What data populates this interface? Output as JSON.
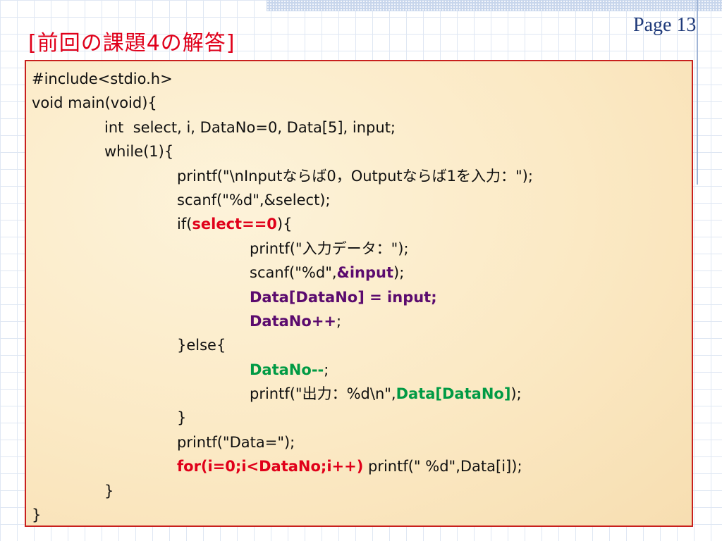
{
  "page_number": "Page 13",
  "title": "[前回の課題4の解答]",
  "colors": {
    "title": "#e0001a",
    "box_border": "#c8201e",
    "highlight_red": "#e0001a",
    "highlight_purple": "#5b0b6e",
    "highlight_green": "#009a44"
  },
  "code": [
    {
      "indent": 0,
      "segments": [
        {
          "text": "#include<stdio.h>",
          "style": "normal"
        }
      ]
    },
    {
      "indent": 0,
      "segments": [
        {
          "text": "void main(void){",
          "style": "normal"
        }
      ]
    },
    {
      "indent": 1,
      "segments": [
        {
          "text": "int  select, i, DataNo=0, Data[5], input;",
          "style": "normal"
        }
      ]
    },
    {
      "indent": 1,
      "segments": [
        {
          "text": "while(1){",
          "style": "normal"
        }
      ]
    },
    {
      "indent": 2,
      "segments": [
        {
          "text": "printf(\"\\nInputならば0，Outputならば1を入力：\");",
          "style": "normal"
        }
      ]
    },
    {
      "indent": 2,
      "segments": [
        {
          "text": "scanf(\"%d\",&select);",
          "style": "normal"
        }
      ]
    },
    {
      "indent": 2,
      "segments": [
        {
          "text": "if(",
          "style": "normal"
        },
        {
          "text": "select==0",
          "style": "red"
        },
        {
          "text": "){",
          "style": "normal"
        }
      ]
    },
    {
      "indent": 3,
      "segments": [
        {
          "text": "printf(\"入力データ：\");",
          "style": "normal"
        }
      ]
    },
    {
      "indent": 3,
      "segments": [
        {
          "text": "scanf(\"%d\",",
          "style": "normal"
        },
        {
          "text": "&input",
          "style": "purple"
        },
        {
          "text": ");",
          "style": "normal"
        }
      ]
    },
    {
      "indent": 3,
      "segments": [
        {
          "text": "Data[DataNo] = input;",
          "style": "purple"
        }
      ]
    },
    {
      "indent": 3,
      "segments": [
        {
          "text": "DataNo++",
          "style": "purple"
        },
        {
          "text": ";",
          "style": "normal"
        }
      ]
    },
    {
      "indent": 2,
      "segments": [
        {
          "text": "}else{",
          "style": "normal"
        }
      ]
    },
    {
      "indent": 3,
      "segments": [
        {
          "text": "DataNo--",
          "style": "green"
        },
        {
          "text": ";",
          "style": "normal"
        }
      ]
    },
    {
      "indent": 3,
      "segments": [
        {
          "text": "printf(\"出力：%d\\n\",",
          "style": "normal"
        },
        {
          "text": "Data[DataNo]",
          "style": "green"
        },
        {
          "text": ");",
          "style": "normal"
        }
      ]
    },
    {
      "indent": 2,
      "segments": [
        {
          "text": "}",
          "style": "normal"
        }
      ]
    },
    {
      "indent": 2,
      "segments": [
        {
          "text": "printf(\"Data=\");",
          "style": "normal"
        }
      ]
    },
    {
      "indent": 2,
      "segments": [
        {
          "text": "for(i=0;i<DataNo;i++)",
          "style": "red"
        },
        {
          "text": " printf(\" %d\",Data[i]);",
          "style": "normal"
        }
      ]
    },
    {
      "indent": 1,
      "segments": [
        {
          "text": "}",
          "style": "normal"
        }
      ]
    },
    {
      "indent": 0,
      "segments": [
        {
          "text": "}",
          "style": "normal"
        }
      ]
    }
  ]
}
